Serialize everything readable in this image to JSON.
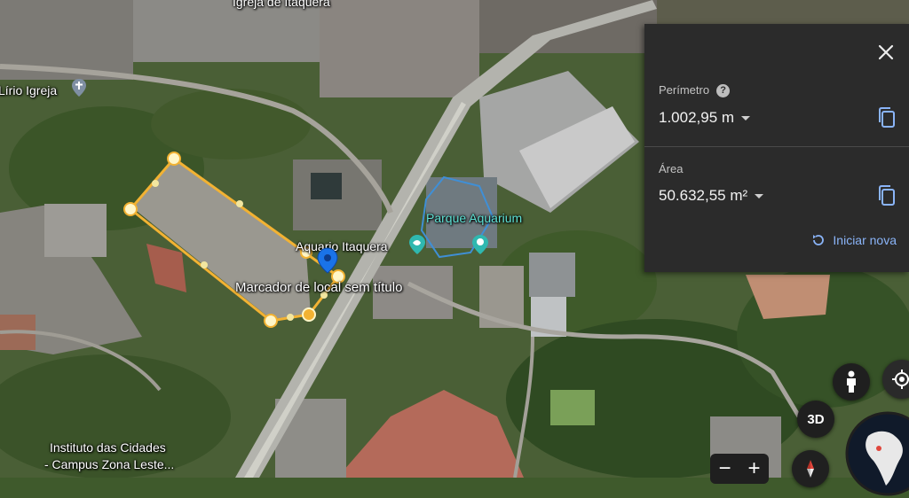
{
  "map": {
    "labels": {
      "igreja_itaquera": "Igreja de Itaquera",
      "lirio_igreja": "Lírio Igreja",
      "parque_aquarium": "Parque Aquarium",
      "aquario_itaquera": "Aquario Itaquera",
      "marcador": "Marcador de local sem título",
      "instituto_line1": "Instituto das Cidades",
      "instituto_line2": "- Campus Zona Leste..."
    }
  },
  "panel": {
    "perimeter_label": "Perímetro",
    "perimeter_value": "1.002,95 m",
    "area_label": "Área",
    "area_value": "50.632,55 m²",
    "restart_label": "Iniciar nova"
  },
  "controls": {
    "threed_label": "3D",
    "zoom_out": "−",
    "zoom_in": "+"
  },
  "colors": {
    "measure_line": "#f2b233",
    "panel_bg": "#2b2b2b",
    "accent": "#8ab4f8",
    "pin": "#1a73e8"
  }
}
